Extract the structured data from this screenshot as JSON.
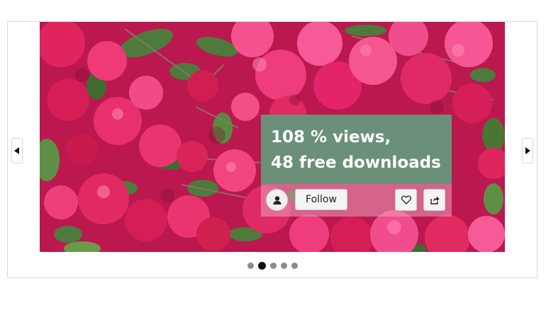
{
  "slide": {
    "image_subject": "pink bougainvillea flowers with green leaves",
    "stats_line1": "108 % views,",
    "stats_line2": "48 free downloads",
    "follow_label": "Follow"
  },
  "navigation": {
    "prev_icon": "triangle-left-icon",
    "next_icon": "triangle-right-icon"
  },
  "icons": {
    "avatar": "user-icon",
    "like": "heart-icon",
    "share": "share-icon"
  },
  "pagination": {
    "count": 5,
    "active_index": 1
  },
  "colors": {
    "overlay_title_bg": "#6c8f79",
    "flower_pink": "#d81b60",
    "leaf_green": "#4f7a3d"
  }
}
